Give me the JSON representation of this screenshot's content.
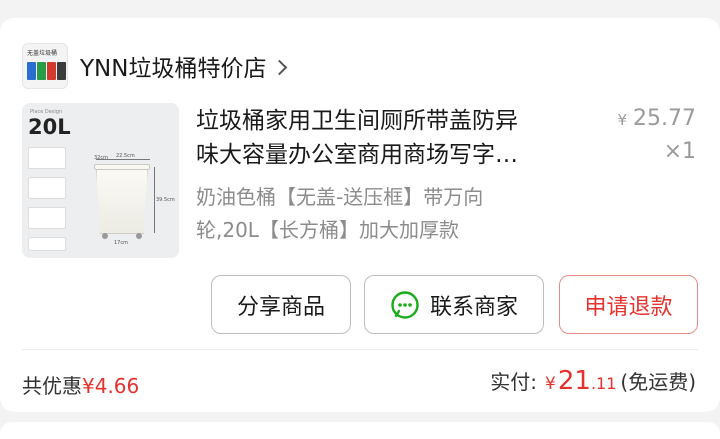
{
  "shop": {
    "logo_text": "无盖垃圾桶",
    "name": "YNN垃圾桶特价店",
    "logo_colors": [
      "#2a6fcf",
      "#2a9c45",
      "#d23a2e",
      "#3c3c3c"
    ]
  },
  "product": {
    "title_line1": "垃圾桶家用卫生间厕所带盖防异",
    "title_line2": "味大容量办公室商用商场写字…",
    "spec_line1": "奶油色桶【无盖-送压框】带万向",
    "spec_line2": "轮,20L【长方桶】加大加厚款",
    "price_symbol": "¥",
    "price": "25.77",
    "quantity": "×1",
    "thumb": {
      "size_label": "20L",
      "tag": "Place Design",
      "dims": [
        "22.5cm",
        "32cm",
        "39.5cm",
        "17cm"
      ]
    }
  },
  "actions": {
    "share": "分享商品",
    "contact": "联系商家",
    "refund": "申请退款"
  },
  "summary": {
    "discount_label": "共优惠",
    "discount_amount": "¥4.66",
    "paid_label": "实付:",
    "paid_symbol": "¥",
    "paid_int": "21",
    "paid_dec": ".11",
    "shipping_note": "(免运费)"
  },
  "colors": {
    "accent_red": "#e5322d",
    "icon_green": "#1aad19"
  }
}
